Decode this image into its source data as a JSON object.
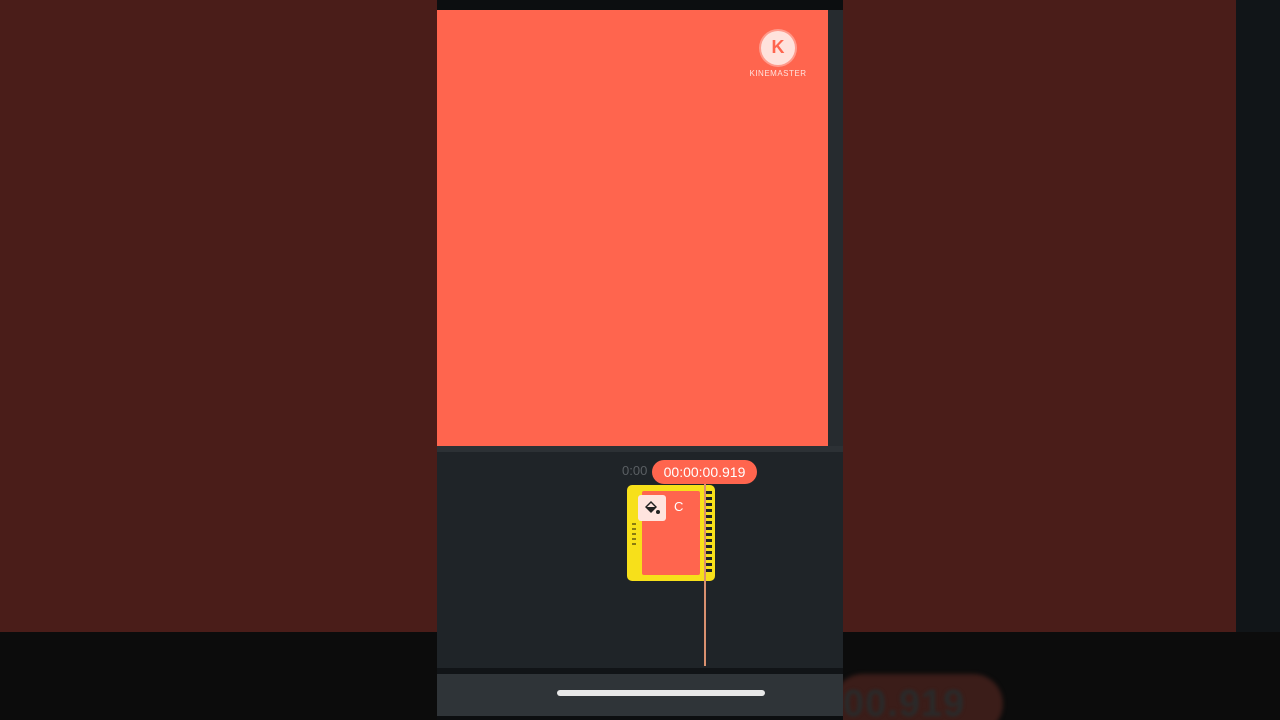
{
  "app": {
    "watermark_letter": "K",
    "watermark_text": "KINEMASTER"
  },
  "timeline": {
    "time_left": "0:00",
    "current_time": "00:00:00.919",
    "clip_label": "C"
  },
  "background": {
    "ghost_time": "00.919"
  },
  "colors": {
    "preview": "#ff654e",
    "clip_selected": "#f7e01a",
    "time_pill": "#ff654e",
    "timeline_bg": "#1f2428"
  },
  "icons": {
    "clip_thumb": "paint-bucket-icon",
    "watermark": "kinemaster-logo-icon"
  }
}
